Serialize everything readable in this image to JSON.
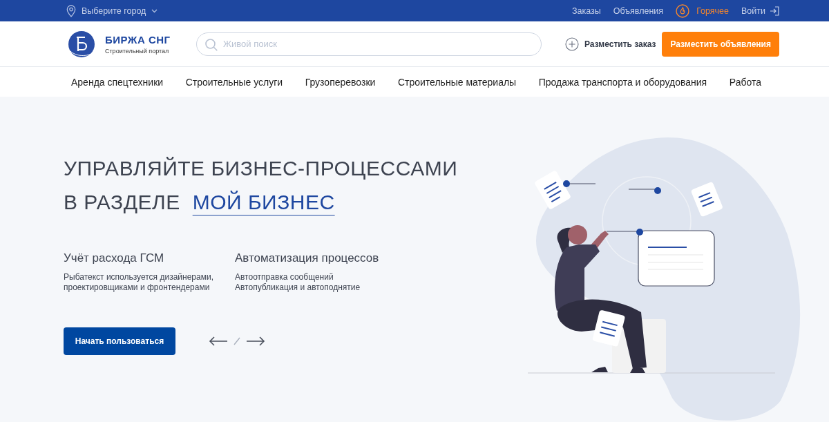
{
  "top_bar": {
    "city": "Выберите город",
    "links": [
      {
        "label": "Заказы",
        "kind": "plain"
      },
      {
        "label": "Объявления",
        "kind": "plain"
      },
      {
        "label": "Горячее",
        "kind": "hot"
      },
      {
        "label": "Войти",
        "kind": "login"
      }
    ]
  },
  "header": {
    "logo_title": "БИРЖА СНГ",
    "logo_subtitle": "Строительный портал",
    "search": {
      "placeholder": "Живой поиск"
    },
    "add_order": "Разместить заказ",
    "add_ad": "Разместить объявления"
  },
  "nav": [
    "Аренда спецтехники",
    "Строительные услуги",
    "Грузоперевозки",
    "Строительные материалы",
    "Продажа транспорта и оборудования",
    "Работа"
  ],
  "hero": {
    "title_line_1": "УПРАВЛЯЙТЕ БИЗНЕС-ПРОЦЕССАМИ",
    "title_line_2": "В РАЗДЕЛЕ",
    "title_link": "МОЙ БИЗНЕС",
    "features": [
      {
        "title": "Учёт расхода ГСМ",
        "lines": [
          "Рыбатекст используется дизайнерами,",
          "проектировщиками и фронтендерами"
        ]
      },
      {
        "title": "Автоматизация процессов",
        "lines": [
          "Автоотправка сообщений",
          "Автопубликация и автоподнятие"
        ]
      }
    ],
    "button": "Начать пользоваться"
  }
}
